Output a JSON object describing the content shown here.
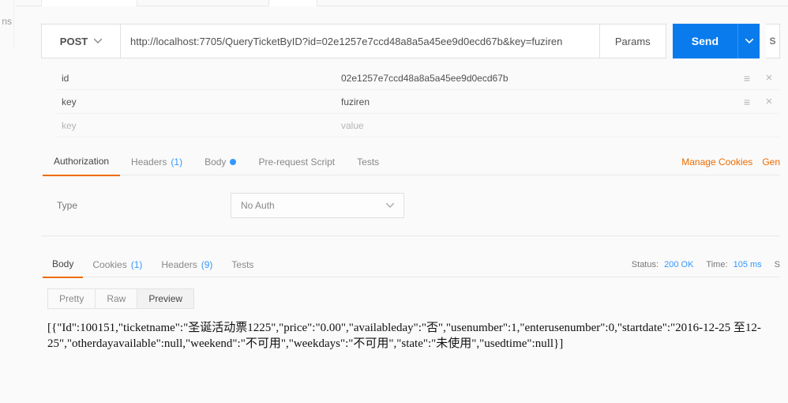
{
  "sidebar_stub": "ns",
  "request": {
    "method": "POST",
    "url": "http://localhost:7705/QueryTicketByID?id=02e1257e7ccd48a8a5a45ee9d0ecd67b&key=fuziren",
    "params_label": "Params",
    "send_label": "Send",
    "extra_char": "S"
  },
  "kv": {
    "rows": [
      {
        "key": "id",
        "value": "02e1257e7ccd48a8a5a45ee9d0ecd67b"
      },
      {
        "key": "key",
        "value": "fuziren"
      }
    ],
    "placeholder_key": "key",
    "placeholder_value": "value"
  },
  "req_tabs": {
    "authorization": "Authorization",
    "headers": "Headers",
    "headers_count": "(1)",
    "body": "Body",
    "prerequest": "Pre-request Script",
    "tests": "Tests",
    "manage_cookies": "Manage Cookies",
    "gen": "Gen"
  },
  "auth": {
    "type_label": "Type",
    "selected": "No Auth"
  },
  "resp_tabs": {
    "body": "Body",
    "cookies": "Cookies",
    "cookies_count": "(1)",
    "headers": "Headers",
    "headers_count": "(9)",
    "tests": "Tests"
  },
  "resp_meta": {
    "status_label": "Status:",
    "status_value": "200 OK",
    "time_label": "Time:",
    "time_value": "105 ms",
    "extra": "S"
  },
  "view_tabs": {
    "pretty": "Pretty",
    "raw": "Raw",
    "preview": "Preview"
  },
  "response_body": "[{\"Id\":100151,\"ticketname\":\"圣诞活动票1225\",\"price\":\"0.00\",\"availableday\":\"否\",\"usenumber\":1,\"enterusenumber\":0,\"startdate\":\"2016-12-25 至12-25\",\"otherdayavailable\":null,\"weekend\":\"不可用\",\"weekdays\":\"不可用\",\"state\":\"未使用\",\"usedtime\":null}]"
}
